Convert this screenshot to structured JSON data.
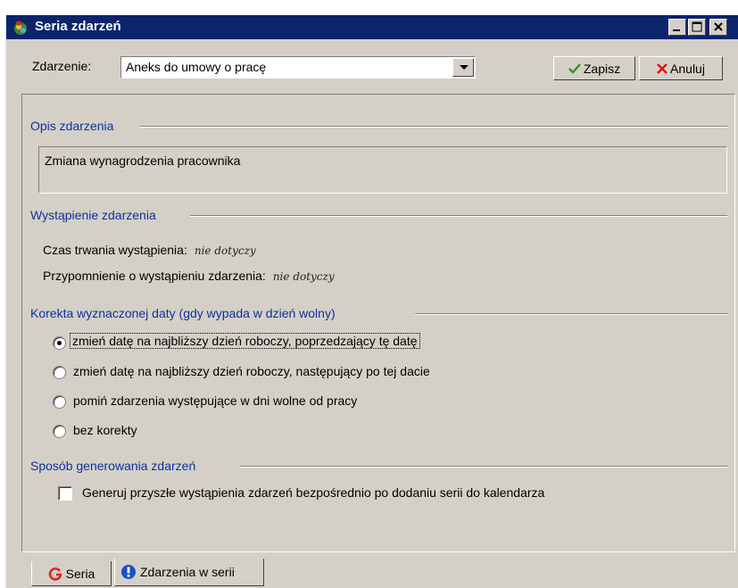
{
  "window": {
    "title": "Seria zdarzeń",
    "icon": "app-icon",
    "titlebar_color": "#0b246a"
  },
  "top": {
    "event_label": "Zdarzenie:",
    "event_value": "Aneks do umowy o pracę",
    "save_label": "Zapisz",
    "cancel_label": "Anuluj"
  },
  "sections": {
    "description": {
      "title": "Opis zdarzenia",
      "text": "Zmiana wynagrodzenia pracownika"
    },
    "occurrence": {
      "title": "Wystąpienie zdarzenia",
      "duration_label": "Czas trwania wystąpienia:",
      "duration_value": "nie dotyczy",
      "reminder_label": "Przypomnienie o wystąpieniu zdarzenia:",
      "reminder_value": "nie dotyczy"
    },
    "correction": {
      "title": "Korekta wyznaczonej daty (gdy wypada w dzień wolny)",
      "options": [
        {
          "label": "zmień datę na najbliższy dzień roboczy, poprzedzający tę datę",
          "selected": true
        },
        {
          "label": "zmień datę na najbliższy dzień roboczy, następujący po tej dacie",
          "selected": false
        },
        {
          "label": "pomiń zdarzenia występujące w dni wolne od pracy",
          "selected": false
        },
        {
          "label": "bez korekty",
          "selected": false
        }
      ]
    },
    "generation": {
      "title": "Sposób generowania zdarzeń",
      "checkbox_label": "Generuj przyszłe wystąpienia zdarzeń bezpośrednio po dodaniu serii do kalendarza",
      "checked": false
    }
  },
  "tabs": [
    {
      "label": "Seria",
      "icon": "g-icon",
      "active": false
    },
    {
      "label": "Zdarzenia w serii",
      "icon": "info-icon",
      "active": true
    }
  ],
  "colors": {
    "section_title": "#0f2f9f",
    "save_check": "#2e9b1e",
    "cancel_x": "#e01010"
  }
}
